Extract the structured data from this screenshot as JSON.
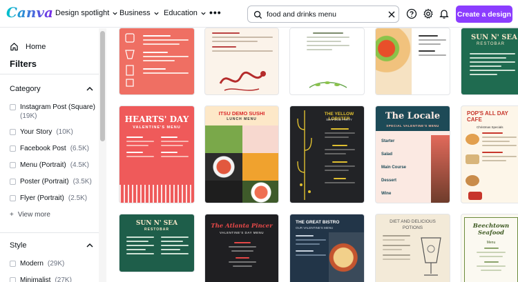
{
  "header": {
    "logo": "Canva",
    "nav": [
      {
        "label": "Design spotlight"
      },
      {
        "label": "Business"
      },
      {
        "label": "Education"
      }
    ],
    "search": {
      "value": "food and drinks menu",
      "placeholder": "Search"
    },
    "cta_label": "Create a design"
  },
  "sidebar": {
    "home_label": "Home",
    "filters_title": "Filters",
    "category": {
      "title": "Category",
      "options": [
        {
          "label": "Instagram Post (Square)",
          "count": "(19K)"
        },
        {
          "label": "Your Story",
          "count": "(10K)"
        },
        {
          "label": "Facebook Post",
          "count": "(6.5K)"
        },
        {
          "label": "Menu (Portrait)",
          "count": "(4.5K)"
        },
        {
          "label": "Poster (Portrait)",
          "count": "(3.5K)"
        },
        {
          "label": "Flyer (Portrait)",
          "count": "(2.5K)"
        }
      ],
      "view_more": "View more"
    },
    "style": {
      "title": "Style",
      "options": [
        {
          "label": "Modern",
          "count": "(29K)"
        },
        {
          "label": "Minimalist",
          "count": "(27K)"
        }
      ]
    }
  },
  "templates": {
    "row2": {
      "hearts_day": {
        "title": "HEARTS' DAY",
        "subtitle": "VALENTINE'S MENU"
      },
      "itsu": {
        "title": "ITSU DEMO SUSHI",
        "subtitle": "LUNCH MENU"
      },
      "lobster": {
        "title": "THE YELLOW LOBSTER",
        "subtitle": "SEAFOOD PARTY"
      },
      "locale": {
        "title": "The Locale",
        "subtitle": "SPECIAL VALENTINE'S MENU",
        "items": [
          "Starter",
          "Salad",
          "Main Course",
          "Dessert",
          "Wine"
        ]
      },
      "pops": {
        "title": "POP'S ALL DAY CAFE",
        "subtitle": "Christmas Specials"
      }
    },
    "row3": {
      "sunnsea": {
        "title": "SUN N' SEA",
        "subtitle": "RESTOBAR"
      },
      "atlanta": {
        "title": "The Atlanta Pincer",
        "subtitle": "VALENTINE'S DAY MENU"
      },
      "bistro": {
        "title": "THE GREAT BISTRO",
        "subtitle": "OUR VALENTINE'S MENU"
      },
      "potions": {
        "title": "DIET AND DELICIOUS POTIONS"
      },
      "beechtown": {
        "title": "Beechtown Seafood",
        "subtitle": "Menu"
      }
    },
    "row1": {
      "sunnsea_top": {
        "title": "SUN N' SEA",
        "subtitle": "RESTOBAR"
      }
    }
  },
  "colors": {
    "brand_purple": "#8b3dff",
    "coral": "#ef5a5a",
    "dark_green": "#1e5e4a"
  }
}
